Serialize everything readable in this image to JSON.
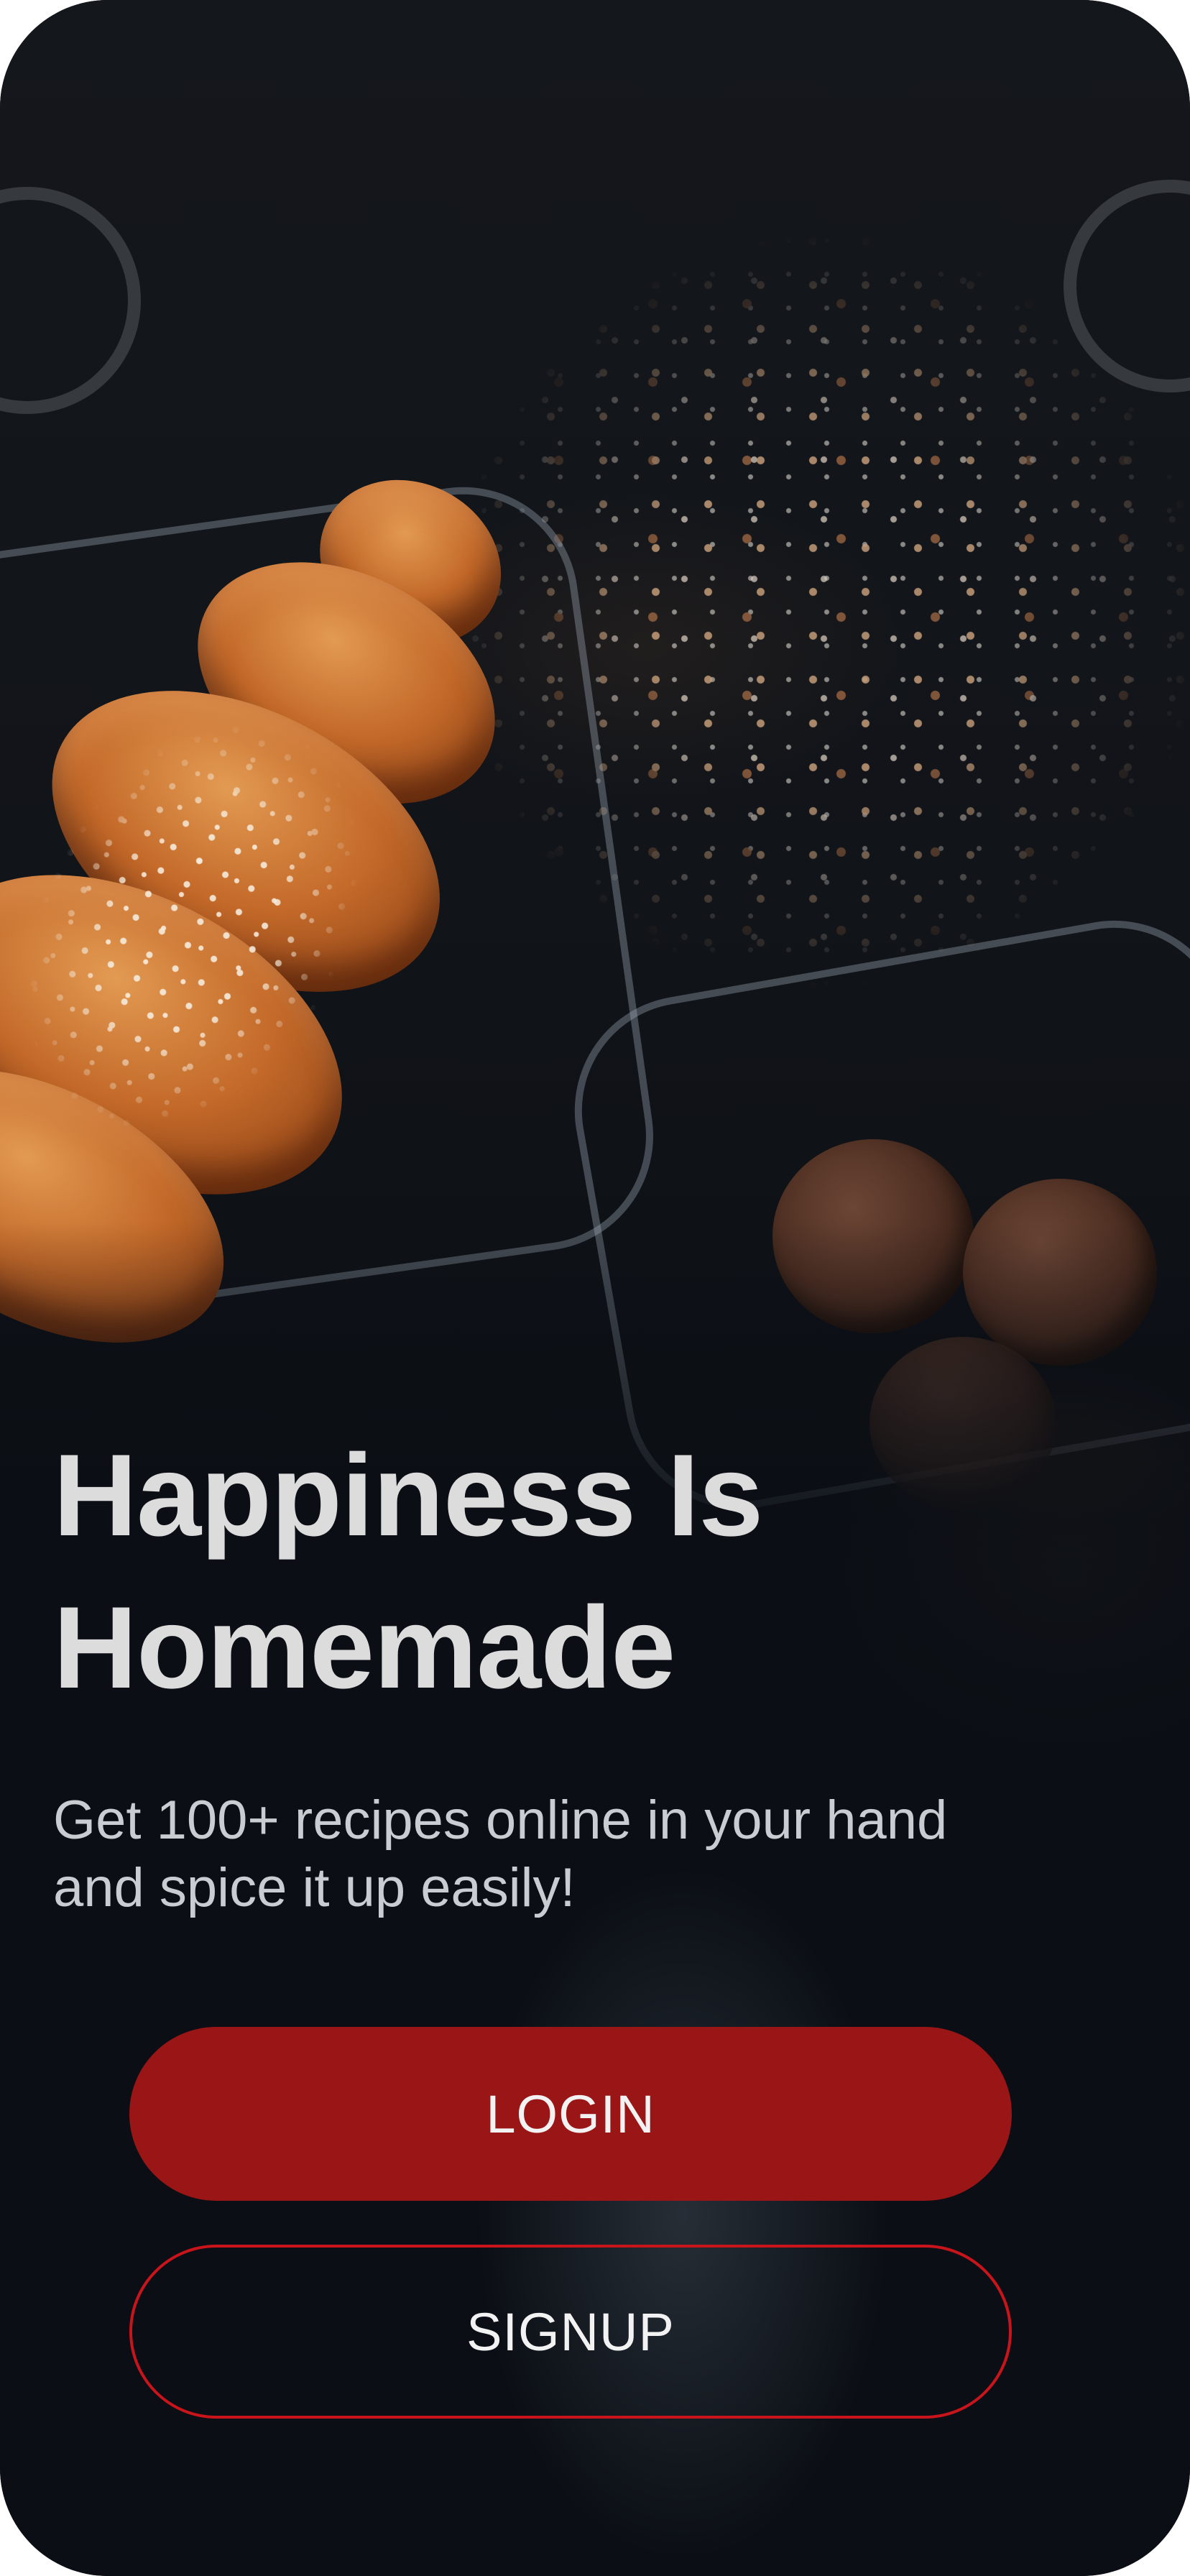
{
  "hero": {
    "headline": "Happiness Is Homemade",
    "subtitle": "Get 100+ recipes online in your hand\nand  spice it up easily!"
  },
  "actions": {
    "login_label": "LOGIN",
    "signup_label": "SIGNUP"
  },
  "colors": {
    "background": "#0b0f15",
    "primary": "#9a1515",
    "outline": "#c8141a",
    "headline_text": "#dcdcdc"
  }
}
